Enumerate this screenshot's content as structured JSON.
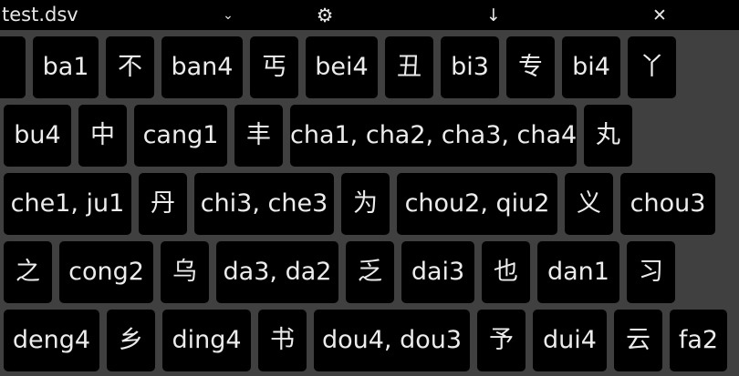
{
  "titlebar": {
    "filename": "test.dsv",
    "icons": {
      "menu": "chevron-down-icon",
      "settings": "gear-icon",
      "download": "arrow-down-icon",
      "close": "close-icon"
    }
  },
  "rows": [
    [
      "",
      "ba1",
      "不",
      "ban4",
      "丐",
      "bei4",
      "丑",
      "bi3",
      "专",
      "bi4",
      "丫"
    ],
    [
      "bu4",
      "中",
      "cang1",
      "丰",
      "cha1, cha2, cha3, cha4",
      "丸"
    ],
    [
      "che1, ju1",
      "丹",
      "chi3, che3",
      "为",
      "chou2, qiu2",
      "义",
      "chou3"
    ],
    [
      "之",
      "cong2",
      "乌",
      "da3, da2",
      "乏",
      "dai3",
      "也",
      "dan1",
      "习"
    ],
    [
      "deng4",
      "乡",
      "ding4",
      "书",
      "dou4, dou3",
      "予",
      "dui4",
      "云",
      "fa2"
    ]
  ],
  "colors": {
    "background": "#404040",
    "key": "#000000",
    "text": "#ececec"
  }
}
